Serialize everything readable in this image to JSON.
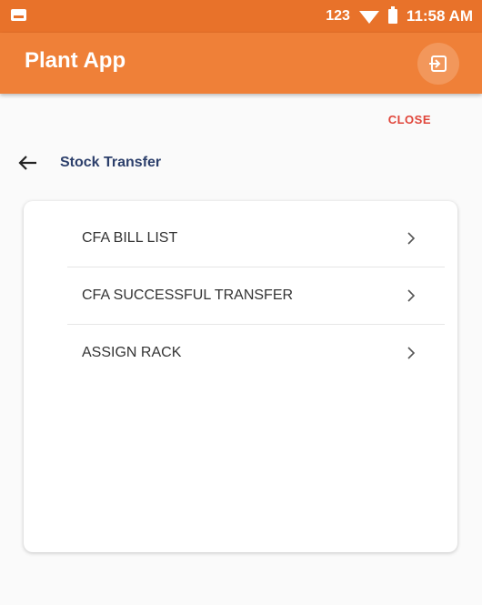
{
  "status_bar": {
    "keyboard_indicator": "123",
    "time": "11:58 AM"
  },
  "app_bar": {
    "title": "Plant App",
    "action_icon": "exit-icon"
  },
  "close_label": "CLOSE",
  "page": {
    "title": "Stock Transfer",
    "back_icon": "arrow-left-icon"
  },
  "menu": {
    "items": [
      {
        "label": "CFA BILL LIST",
        "icon": "chevron-right-icon"
      },
      {
        "label": "CFA SUCCESSFUL TRANSFER",
        "icon": "chevron-right-icon"
      },
      {
        "label": "ASSIGN RACK",
        "icon": "chevron-right-icon"
      }
    ]
  },
  "colors": {
    "status_bar": "#e8722a",
    "app_bar": "#ef8038",
    "close_text": "#e0453a",
    "page_title": "#2c3f6b"
  }
}
